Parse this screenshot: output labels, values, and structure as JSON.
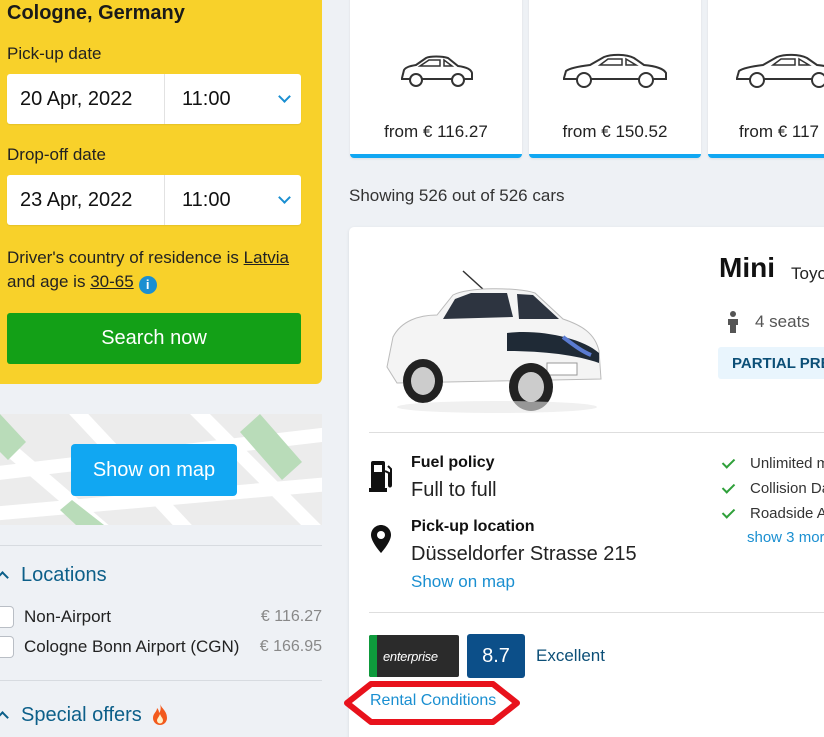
{
  "search": {
    "location": "Cologne, Germany",
    "pickup_label": "Pick-up date",
    "pickup_date": "20 Apr, 2022",
    "pickup_time": "11:00",
    "dropoff_label": "Drop-off date",
    "dropoff_date": "23 Apr, 2022",
    "dropoff_time": "11:00",
    "residence_prefix": "Driver's country of residence is",
    "country": "Latvia",
    "age_prefix": "and age is",
    "age": "30-65",
    "button": "Search now"
  },
  "map": {
    "button": "Show on map"
  },
  "filters": {
    "locations_title": "Locations",
    "locations": [
      {
        "label": "Non-Airport",
        "price": "€ 116.27"
      },
      {
        "label": "Cologne Bonn Airport (CGN)",
        "price": "€ 166.95"
      }
    ],
    "special_offers_title": "Special offers",
    "special_offers_icon": "fire-icon"
  },
  "categories": [
    {
      "price": "from € 116.27"
    },
    {
      "price": "from € 150.52"
    },
    {
      "price": "from € 117"
    }
  ],
  "results": {
    "showing": "Showing 526 out of 526 cars"
  },
  "car": {
    "type": "Mini",
    "model": "Toyo",
    "seats": "4 seats",
    "tag": "PARTIAL PRE",
    "fuel_label": "Fuel policy",
    "fuel_value": "Full to full",
    "pickup_label": "Pick-up location",
    "pickup_value": "Düsseldorfer Strasse 215",
    "pickup_map_link": "Show on map",
    "includes": [
      "Unlimited m",
      "Collision Da",
      "Roadside A"
    ],
    "show_more": "show 3 mor",
    "supplier": "enterprise",
    "rating": "8.7",
    "rating_label": "Excellent",
    "rental_conditions": "Rental Conditions"
  },
  "colors": {
    "search_panel": "#f8d12a",
    "search_button": "#13a017",
    "accent": "#11a7f2",
    "link": "#1a8fd1",
    "annotation": "#e8121c"
  }
}
